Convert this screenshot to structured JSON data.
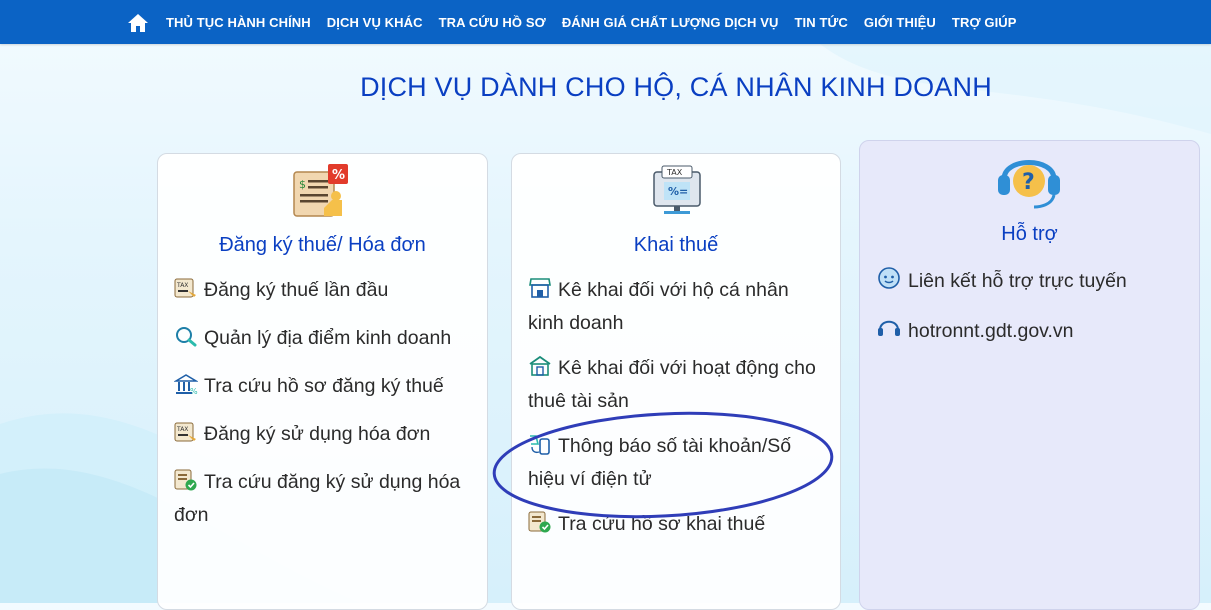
{
  "nav": {
    "items": [
      "THỦ TỤC HÀNH CHÍNH",
      "DỊCH VỤ KHÁC",
      "TRA CỨU HỒ SƠ",
      "ĐÁNH GIÁ CHẤT LƯỢNG DỊCH VỤ",
      "TIN TỨC",
      "GIỚI THIỆU",
      "TRỢ GIÚP"
    ]
  },
  "page": {
    "title": "DỊCH VỤ DÀNH CHO HỘ, CÁ NHÂN KINH DOANH"
  },
  "cards": [
    {
      "title": "Đăng ký thuế/ Hóa đơn",
      "items": [
        "Đăng ký thuế lần đầu",
        "Quản lý địa điểm kinh doanh",
        "Tra cứu hồ sơ đăng ký thuế",
        "Đăng ký sử dụng hóa đơn",
        "Tra cứu đăng ký sử dụng hóa đơn"
      ]
    },
    {
      "title": "Khai thuế",
      "items": [
        "Kê khai đối với hộ cá nhân kinh doanh",
        "Kê khai đối với hoạt động cho thuê tài sản",
        "Thông báo số tài khoản/Số hiệu ví điện tử",
        "Tra cứu hồ sơ khai thuế"
      ]
    },
    {
      "title": "Hỗ trợ",
      "items": [
        "Liên kết hỗ trợ trực tuyến",
        "hotronnt.gdt.gov.vn"
      ]
    }
  ],
  "colors": {
    "nav_bg": "#0b63c5",
    "title": "#0a3fc2",
    "support_bg": "#e7e9fa",
    "ellipse": "#2f3db8"
  }
}
